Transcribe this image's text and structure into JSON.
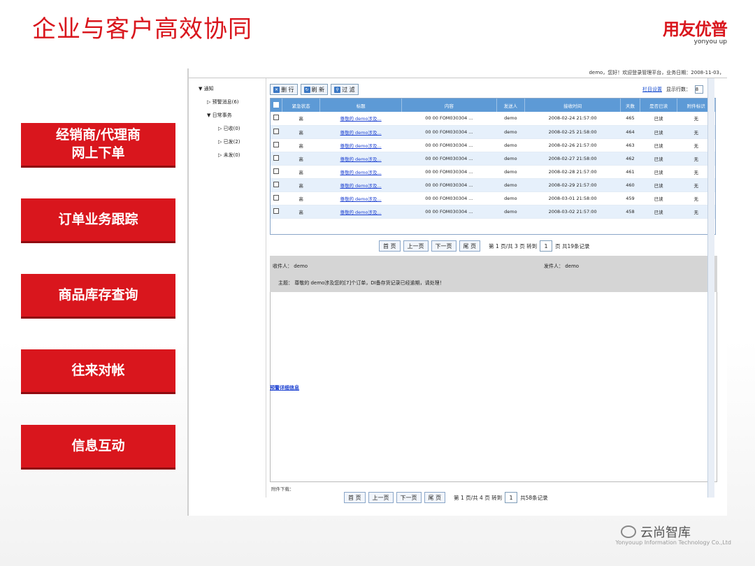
{
  "slide": {
    "title": "企业与客户高效协同",
    "logo_cn": "用友优普",
    "logo_en": "yonyou up",
    "watermark": "云尚智库",
    "company": "Yonyouup Information Technology Co.,Ltd"
  },
  "left_buttons": [
    {
      "label": "经销商/代理商\n网上下单"
    },
    {
      "label": "订单业务跟踪"
    },
    {
      "label": "商品库存查询"
    },
    {
      "label": "往来对帐"
    },
    {
      "label": "信息互动"
    }
  ],
  "screenshot": {
    "topbar": "demo，您好！欢迎登录管理平台，业务日期：2008-11-03，",
    "tree": [
      {
        "label": "通知",
        "level": 0
      },
      {
        "label": "预警消息(6)",
        "level": 1
      },
      {
        "label": "日常事务",
        "level": 1
      },
      {
        "label": "已收(0)",
        "level": 2
      },
      {
        "label": "已发(2)",
        "level": 2
      },
      {
        "label": "未发(0)",
        "level": 2
      }
    ],
    "toolbar": [
      {
        "label": "删 行",
        "icon": "delete-icon"
      },
      {
        "label": "刷 新",
        "icon": "refresh-icon"
      },
      {
        "label": "过 滤",
        "icon": "filter-icon"
      }
    ],
    "topright": {
      "link": "栏目设置",
      "rows_label": "显示行数：",
      "rows_value": "8"
    },
    "columns": [
      "",
      "紧急状态",
      "标题",
      "内容",
      "发送人",
      "接收时间",
      "天数",
      "是否已读",
      "附件标识"
    ],
    "rows": [
      [
        "",
        "高",
        "尊敬的 demo涉及...",
        "00 00 FOM030304 ...",
        "demo",
        "2008-02-24 21:57:00",
        "465",
        "已读",
        "无"
      ],
      [
        "",
        "高",
        "尊敬的 demo涉及...",
        "00 00 FOM030304 ...",
        "demo",
        "2008-02-25 21:58:00",
        "464",
        "已读",
        "无"
      ],
      [
        "",
        "高",
        "尊敬的 demo涉及...",
        "00 00 FOM030304 ...",
        "demo",
        "2008-02-26 21:57:00",
        "463",
        "已读",
        "无"
      ],
      [
        "",
        "高",
        "尊敬的 demo涉及...",
        "00 00 FOM030304 ...",
        "demo",
        "2008-02-27 21:58:00",
        "462",
        "已读",
        "无"
      ],
      [
        "",
        "高",
        "尊敬的 demo涉及...",
        "00 00 FOM030304 ...",
        "demo",
        "2008-02-28 21:57:00",
        "461",
        "已读",
        "无"
      ],
      [
        "",
        "高",
        "尊敬的 demo涉及...",
        "00 00 FOM030304 ...",
        "demo",
        "2008-02-29 21:57:00",
        "460",
        "已读",
        "无"
      ],
      [
        "",
        "高",
        "尊敬的 demo涉及...",
        "00 00 FOM030304 ...",
        "demo",
        "2008-03-01 21:58:00",
        "459",
        "已读",
        "无"
      ],
      [
        "",
        "高",
        "尊敬的 demo涉及...",
        "00 00 FOM030304 ...",
        "demo",
        "2008-03-02 21:57:00",
        "458",
        "已读",
        "无"
      ]
    ],
    "pager1": {
      "first": "首 页",
      "prev": "上一页",
      "next": "下一页",
      "last": "尾 页",
      "info": "第 1 页/共 3 页 转到",
      "page": "1",
      "total": "页 共19条记录"
    },
    "detail": {
      "receiver": "收件人： demo",
      "sender": "发件人： demo",
      "subject": "主题： 尊敬的 demo涉及您的[7]个订单，DI备存货记录已经逾期，请处理！",
      "link": "预警详细信息",
      "footer": "附件下载："
    },
    "pager2": {
      "first": "首 页",
      "prev": "上一页",
      "next": "下一页",
      "last": "尾 页",
      "info": "第 1 页/共 4 页 转到",
      "page": "1",
      "total": "共58条记录"
    }
  }
}
